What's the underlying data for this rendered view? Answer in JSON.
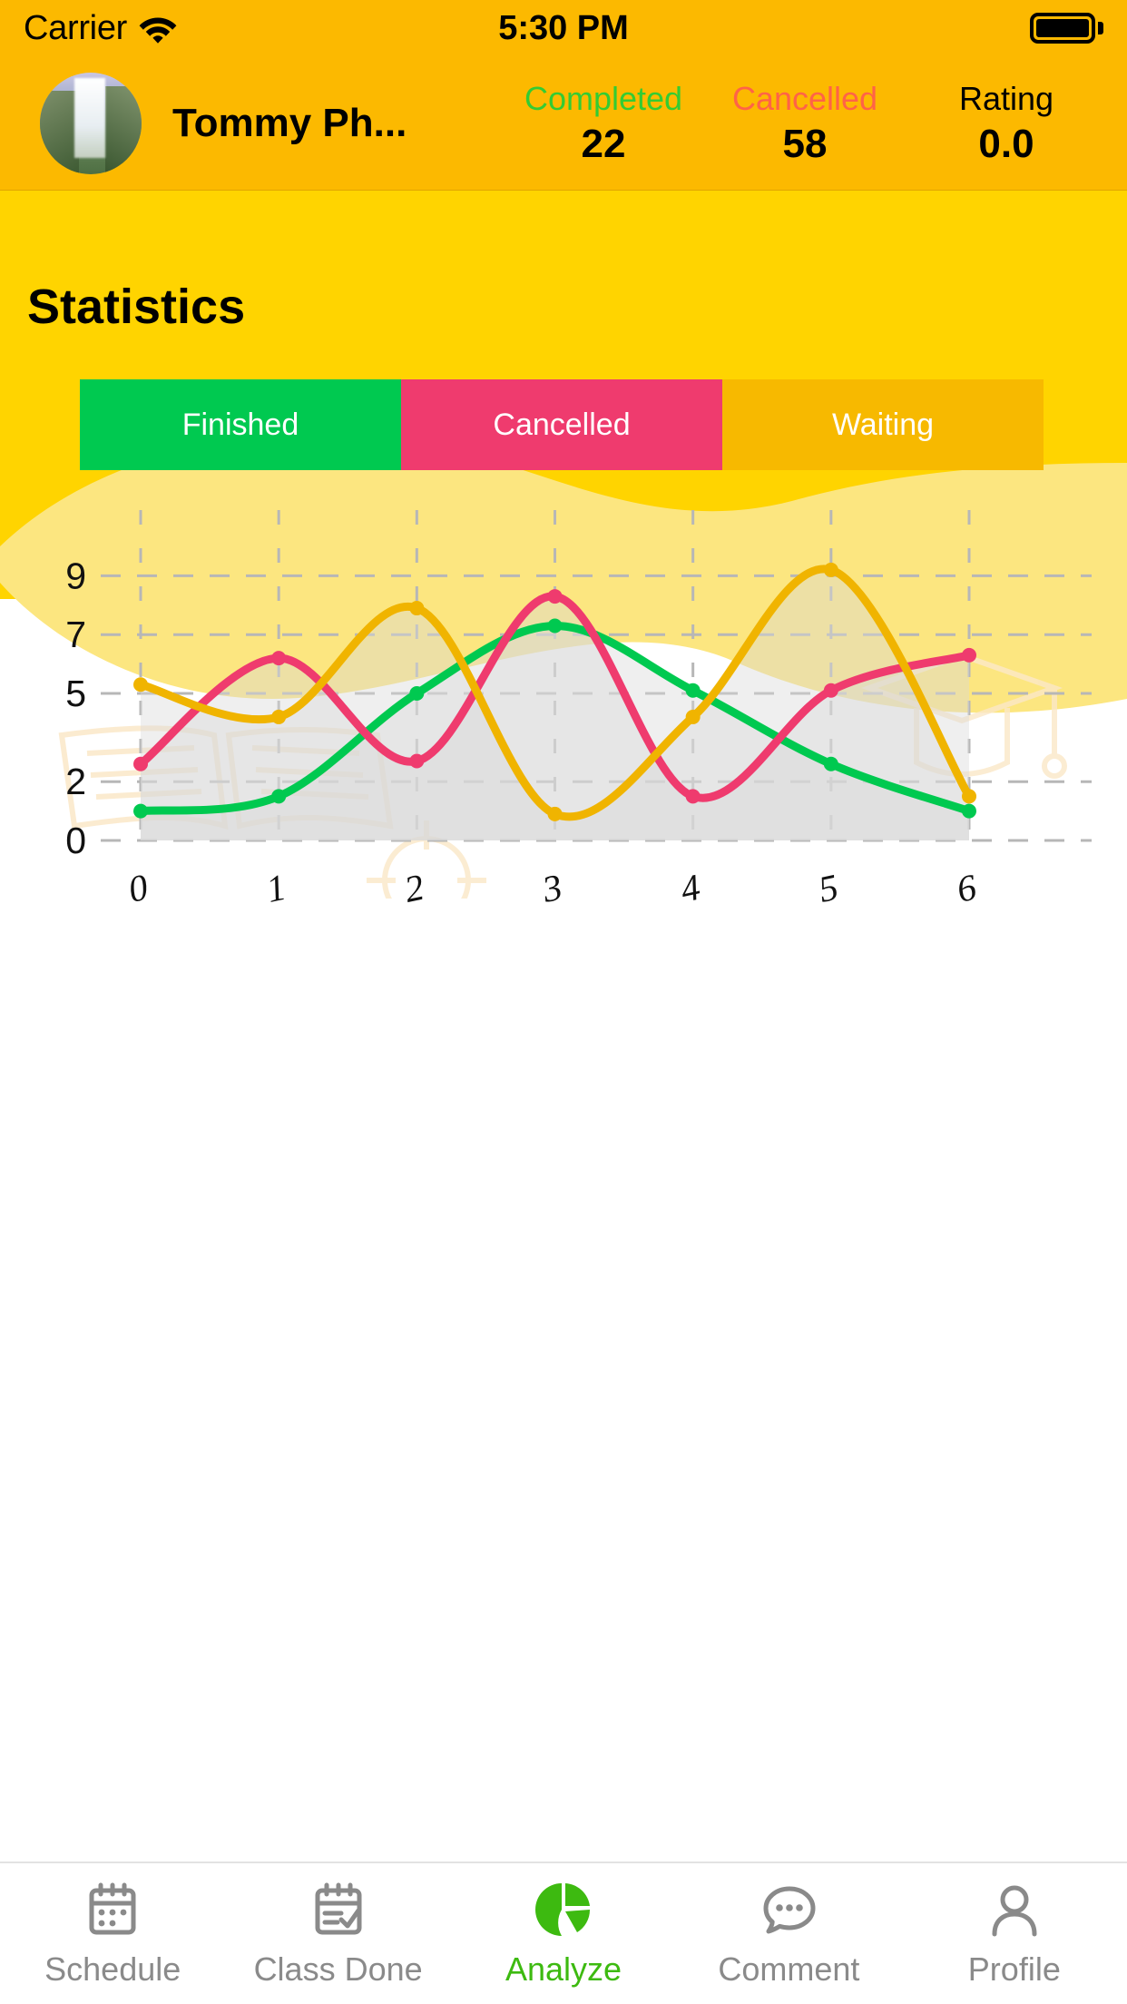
{
  "status_bar": {
    "carrier": "Carrier",
    "wifi_icon": "wifi-icon",
    "time": "5:30 PM",
    "battery_icon": "battery-full-icon"
  },
  "profile_header": {
    "avatar_icon": "avatar-waterfall-photo",
    "user_name": "Tommy Ph...",
    "stats": [
      {
        "label": "Completed",
        "value": "22",
        "color": "#33CC33"
      },
      {
        "label": "Cancelled",
        "value": "58",
        "color": "#FF6347"
      },
      {
        "label": "Rating",
        "value": "0.0",
        "color": "#000000"
      }
    ]
  },
  "main": {
    "page_title": "Statistics",
    "tabs": [
      {
        "label": "Finished",
        "color": "#00C950",
        "active": true
      },
      {
        "label": "Cancelled",
        "color": "#EF3B6E",
        "active": false
      },
      {
        "label": "Waiting",
        "color": "#F7B900",
        "active": false
      }
    ]
  },
  "chart_data": {
    "type": "line",
    "title": "Statistics",
    "xlabel": "",
    "ylabel": "",
    "x": [
      0,
      1,
      2,
      3,
      4,
      5,
      6
    ],
    "x_tick_labels": [
      "0",
      "1",
      "2",
      "3",
      "4",
      "5",
      "6"
    ],
    "y_tick_labels": [
      "0",
      "2",
      "5",
      "7",
      "9"
    ],
    "y_tick_values": [
      0,
      2,
      5,
      7,
      9
    ],
    "ylim": [
      0,
      10
    ],
    "xlim": [
      0,
      6
    ],
    "grid": true,
    "legend": "none",
    "area_fill": true,
    "area_fill_color": "#D8D8D8",
    "markers": true,
    "smoothing": "spline",
    "series": [
      {
        "name": "Finished",
        "color": "#00C950",
        "values": [
          1.0,
          1.5,
          5.0,
          7.3,
          5.1,
          2.6,
          1.0
        ]
      },
      {
        "name": "Cancelled",
        "color": "#EF3B6E",
        "values": [
          2.6,
          6.2,
          2.7,
          8.3,
          1.5,
          5.1,
          6.3
        ]
      },
      {
        "name": "Waiting",
        "color": "#F0B400",
        "values": [
          5.3,
          4.2,
          7.9,
          0.9,
          4.2,
          9.2,
          1.5
        ]
      }
    ]
  },
  "bottom_nav": {
    "items": [
      {
        "label": "Schedule",
        "icon": "calendar-icon",
        "active": false
      },
      {
        "label": "Class Done",
        "icon": "calendar-check-icon",
        "active": false
      },
      {
        "label": "Analyze",
        "icon": "pie-chart-icon",
        "active": true
      },
      {
        "label": "Comment",
        "icon": "chat-bubble-icon",
        "active": false
      },
      {
        "label": "Profile",
        "icon": "user-icon",
        "active": false
      }
    ],
    "active_color": "#3DBA10",
    "inactive_color": "#8A8A8A"
  }
}
